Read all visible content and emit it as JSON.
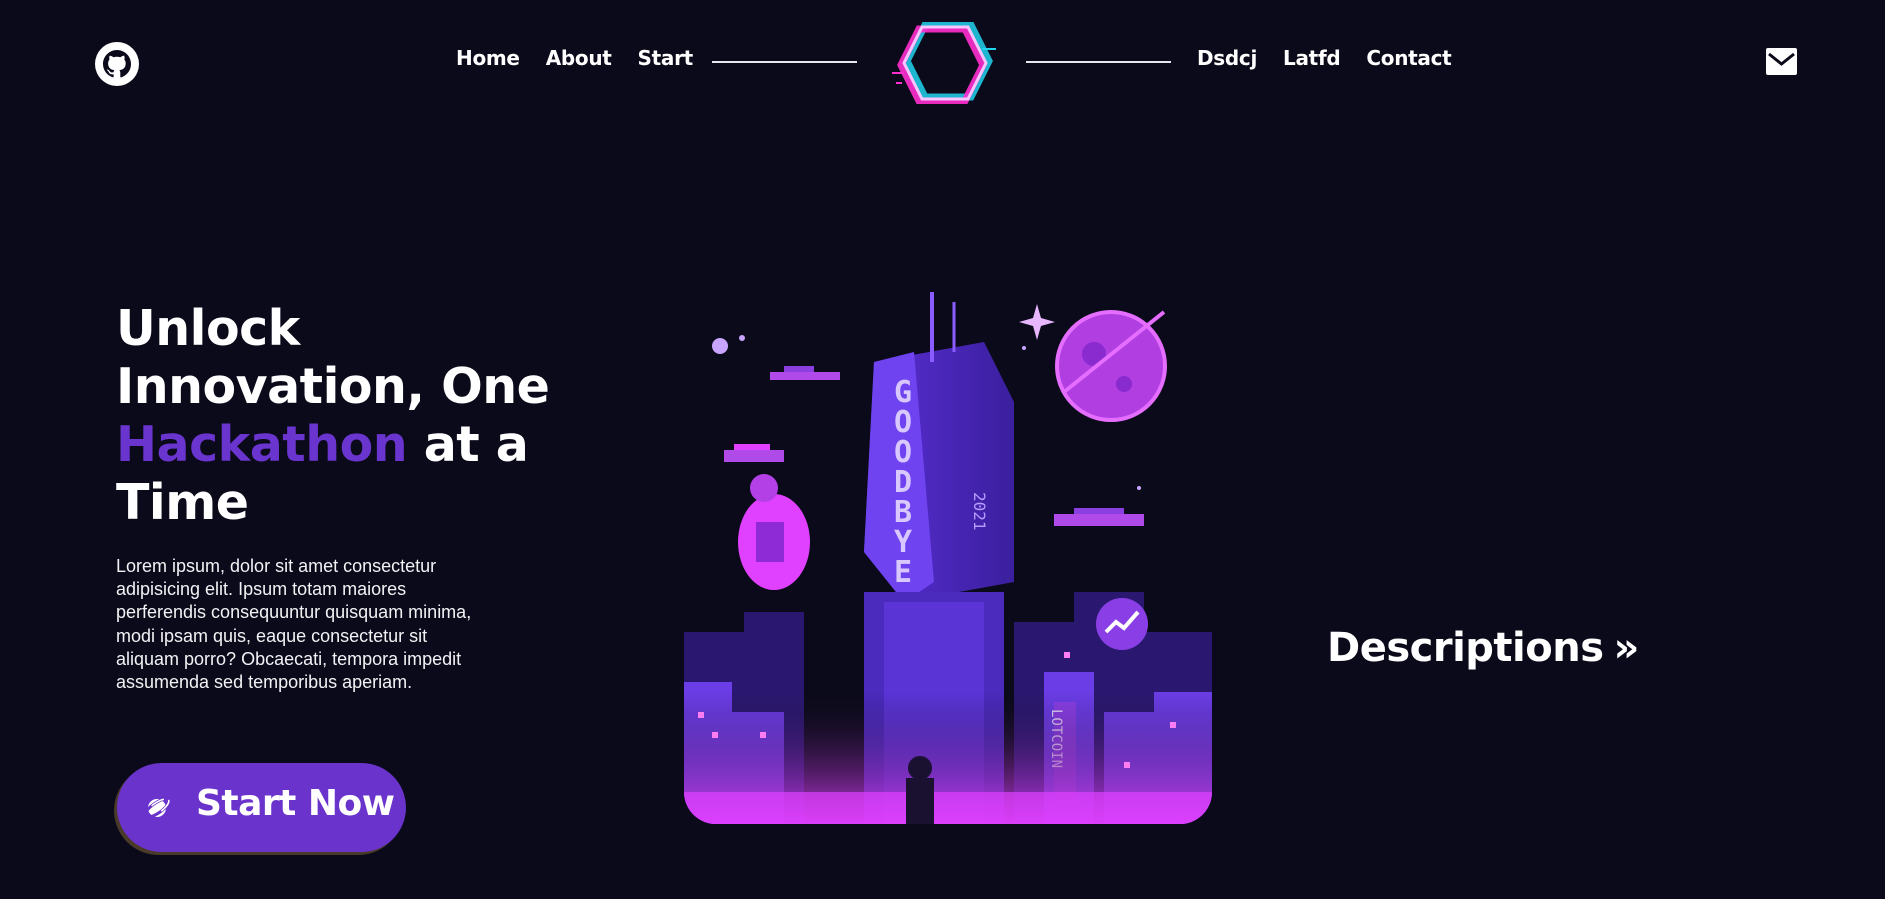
{
  "nav": {
    "left_links": [
      "Home",
      "About",
      "Start"
    ],
    "right_links": [
      "Dsdcj",
      "Latfd",
      "Contact"
    ],
    "github_icon": "github-icon",
    "mail_icon": "mail-icon",
    "logo_icon": "glitch-hexagon-logo"
  },
  "hero": {
    "title_line1": "Unlock",
    "title_line2": "Innovation, One",
    "title_accent": "Hackathon",
    "title_after_accent": " at a",
    "title_line4": "Time",
    "description": "Lorem ipsum, dolor sit amet consectetur adipisicing elit. Ipsum totam maiores perferendis consequuntur quisquam minima, modi ipsam quis, eaque consectetur sit aliquam porro? Obcaecati, tempora impedit assumenda sed temporibus aperiam.",
    "cta_label": "Start Now",
    "cta_icon": "planet-icon"
  },
  "illustration": {
    "tower_text": "GOODBYE",
    "tower_subtext": "2021",
    "sign_text": "LOTCOIN"
  },
  "aside": {
    "link_label": "Descriptions",
    "chevron": "»"
  },
  "colors": {
    "background": "#0b0a1a",
    "accent": "#6a35cf",
    "button": "#6a33cc",
    "text": "#ffffff",
    "magenta": "#e040ff"
  }
}
